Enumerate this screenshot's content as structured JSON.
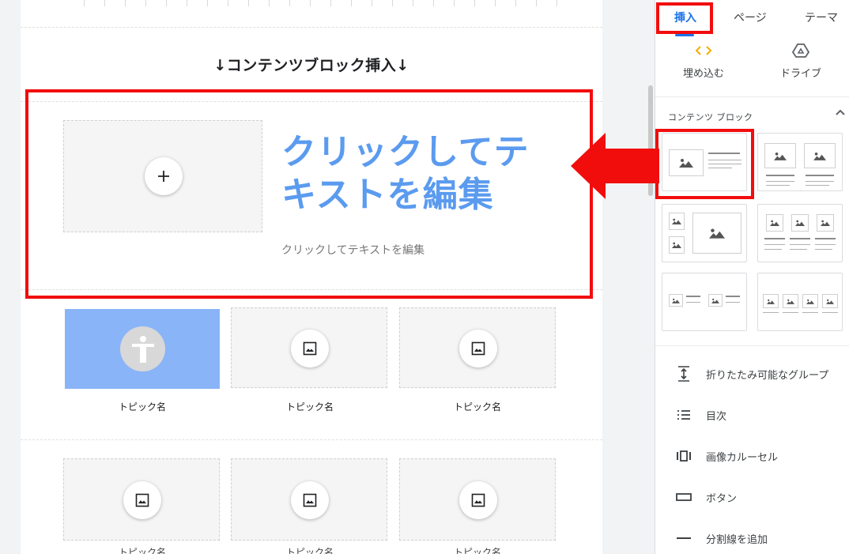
{
  "page": {
    "section_heading": "↓コンテンツブロック挿入↓",
    "block_title": "クリックしてテキストを編集",
    "block_body": "クリックしてテキストを編集",
    "topic_label": "トピック名",
    "cut_label": "トピック名"
  },
  "panel": {
    "tabs": [
      "挿入",
      "ページ",
      "テーマ"
    ],
    "insert_items": [
      {
        "label": "埋め込む",
        "icon": "embed-icon"
      },
      {
        "label": "ドライブ",
        "icon": "drive-icon"
      }
    ],
    "section_title": "コンテンツ ブロック",
    "list_items": [
      {
        "label": "折りたたみ可能なグループ",
        "icon": "collapsible-group-icon"
      },
      {
        "label": "目次",
        "icon": "table-of-contents-icon"
      },
      {
        "label": "画像カルーセル",
        "icon": "image-carousel-icon"
      },
      {
        "label": "ボタン",
        "icon": "button-icon"
      },
      {
        "label": "分割線を追加",
        "icon": "divider-icon"
      }
    ]
  },
  "colors": {
    "accent": "#1a73e8",
    "title_blue": "#5b9bef",
    "highlight_red": "#f20d0d",
    "tile_blue": "#8ab4f8"
  }
}
